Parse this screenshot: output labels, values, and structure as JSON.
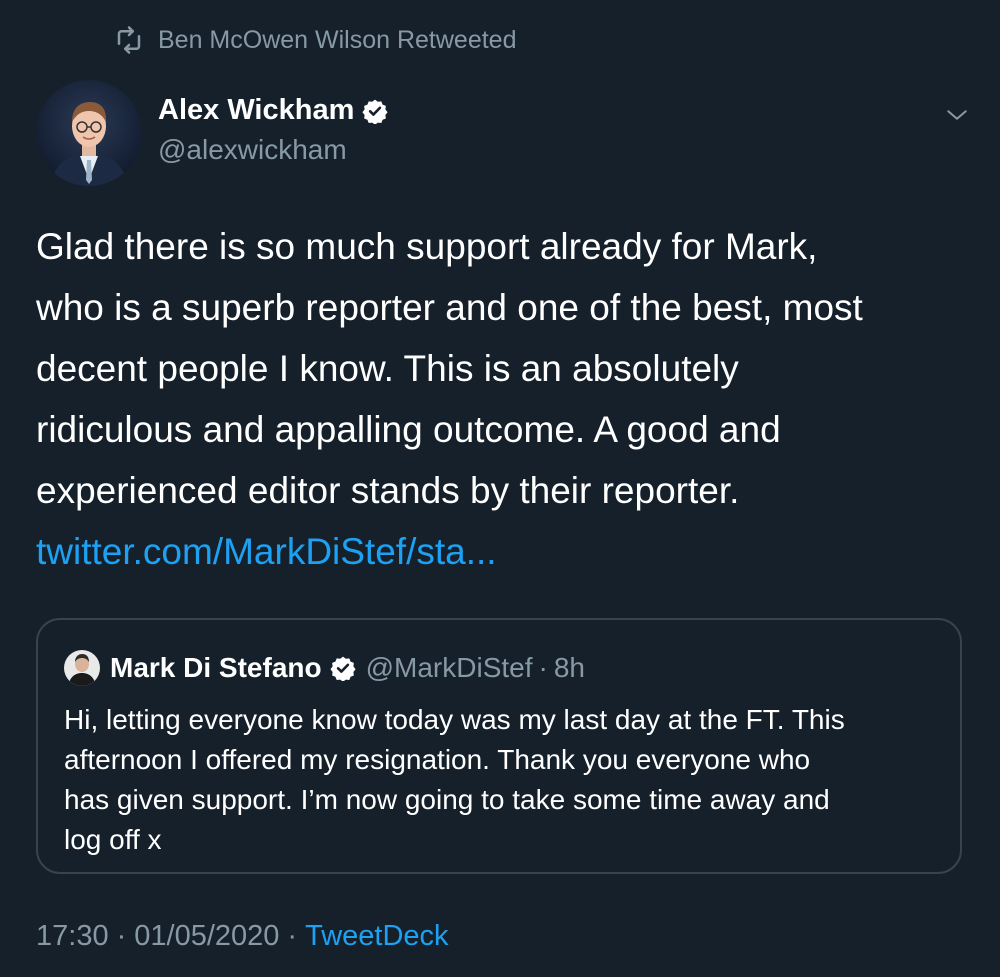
{
  "retweet_context": {
    "text": "Ben McOwen Wilson Retweeted",
    "icon": "retweet-icon"
  },
  "tweet": {
    "author": {
      "name": "Alex Wickham",
      "handle": "@alexwickham",
      "verified": true,
      "avatar_icon": "avatar-photo"
    },
    "text_lines": [
      "Glad there is so much support already for Mark,",
      "who is a superb reporter and one of the best, most",
      "decent people I know. This is an absolutely",
      "ridiculous and appalling outcome. A good and",
      "experienced editor stands by their reporter."
    ],
    "link_text": "twitter.com/MarkDiStef/sta...",
    "timestamp_time": "17:30",
    "timestamp_date": "01/05/2020",
    "separator": "·",
    "source": "TweetDeck"
  },
  "quoted_tweet": {
    "author": {
      "name": "Mark Di Stefano",
      "handle": "@MarkDiStef",
      "verified": true,
      "avatar_icon": "avatar-photo"
    },
    "separator": "·",
    "time": "8h",
    "text_lines": [
      "Hi, letting everyone know today was my last day at the FT. This",
      "afternoon I offered my resignation. Thank you everyone who",
      "has given support. I’m now going to take some time away and",
      "log off x"
    ]
  },
  "colors": {
    "background": "#15202b",
    "text_primary": "#ffffff",
    "text_secondary": "#8899a6",
    "link": "#1da1f2",
    "border": "#38444d"
  }
}
